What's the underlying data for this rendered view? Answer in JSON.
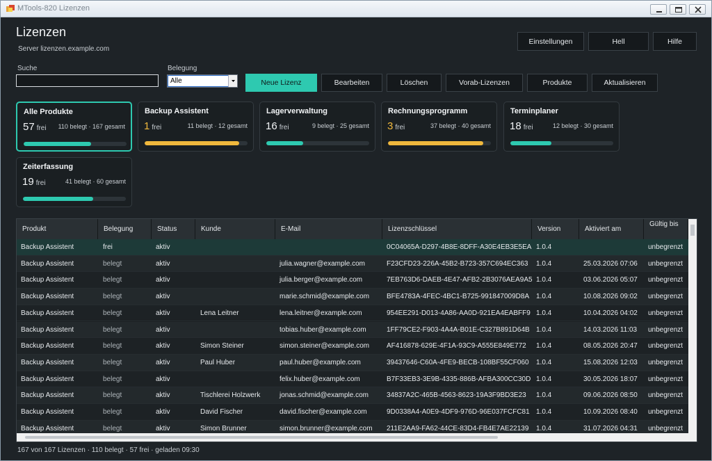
{
  "window": {
    "title": "MTools-820 Lizenzen"
  },
  "header": {
    "title": "Lizenzen",
    "server": "Server lizenzen.example.com",
    "buttons": {
      "settings": "Einstellungen",
      "theme": "Hell",
      "help": "Hilfe"
    }
  },
  "filters": {
    "search_label": "Suche",
    "search_value": "",
    "belegung_label": "Belegung",
    "belegung_value": "Alle"
  },
  "actions": {
    "new": "Neue Lizenz",
    "edit": "Bearbeiten",
    "delete": "Löschen",
    "prelicenses": "Vorab-Lizenzen",
    "products": "Produkte",
    "refresh": "Aktualisieren"
  },
  "colors": {
    "accent": "#2ec9b0",
    "warning": "#f0b83c",
    "background": "#1e2327"
  },
  "cards": [
    {
      "name": "Alle Produkte",
      "free": "57",
      "free_label": "frei",
      "stats": "110 belegt · 167 gesamt",
      "used": 110,
      "total": 167,
      "warn": false,
      "active": true
    },
    {
      "name": "Backup Assistent",
      "free": "1",
      "free_label": "frei",
      "stats": "11 belegt · 12 gesamt",
      "used": 11,
      "total": 12,
      "warn": true,
      "active": false
    },
    {
      "name": "Lagerverwaltung",
      "free": "16",
      "free_label": "frei",
      "stats": "9 belegt · 25 gesamt",
      "used": 9,
      "total": 25,
      "warn": false,
      "active": false
    },
    {
      "name": "Rechnungsprogramm",
      "free": "3",
      "free_label": "frei",
      "stats": "37 belegt · 40 gesamt",
      "used": 37,
      "total": 40,
      "warn": true,
      "active": false
    },
    {
      "name": "Terminplaner",
      "free": "18",
      "free_label": "frei",
      "stats": "12 belegt · 30 gesamt",
      "used": 12,
      "total": 30,
      "warn": false,
      "active": false
    },
    {
      "name": "Zeiterfassung",
      "free": "19",
      "free_label": "frei",
      "stats": "41 belegt · 60 gesamt",
      "used": 41,
      "total": 60,
      "warn": false,
      "active": false
    }
  ],
  "table": {
    "columns": [
      "Produkt",
      "Belegung",
      "Status",
      "Kunde",
      "E-Mail",
      "Lizenzschlüssel",
      "Version",
      "Aktiviert am",
      "Gültig bis"
    ],
    "rows": [
      [
        "Backup Assistent",
        "frei",
        "aktiv",
        "",
        "",
        "0C04065A-D297-4B8E-8DFF-A30E4EB3E5EA",
        "1.0.4",
        "",
        "unbegrenzt"
      ],
      [
        "Backup Assistent",
        "belegt",
        "aktiv",
        "",
        "julia.wagner@example.com",
        "F23CFD23-226A-45B2-B723-357C694EC363",
        "1.0.4",
        "25.03.2026 07:06",
        "unbegrenzt"
      ],
      [
        "Backup Assistent",
        "belegt",
        "aktiv",
        "",
        "julia.berger@example.com",
        "7EB763D6-DAEB-4E47-AFB2-2B3076AEA9A5",
        "1.0.4",
        "03.06.2026 05:07",
        "unbegrenzt"
      ],
      [
        "Backup Assistent",
        "belegt",
        "aktiv",
        "",
        "marie.schmid@example.com",
        "BFE4783A-4FEC-4BC1-B725-991847009D8A",
        "1.0.4",
        "10.08.2026 09:02",
        "unbegrenzt"
      ],
      [
        "Backup Assistent",
        "belegt",
        "aktiv",
        "Lena Leitner",
        "lena.leitner@example.com",
        "954EE291-D013-4A86-AA0D-921EA4EABFF9",
        "1.0.4",
        "10.04.2026 04:02",
        "unbegrenzt"
      ],
      [
        "Backup Assistent",
        "belegt",
        "aktiv",
        "",
        "tobias.huber@example.com",
        "1FF79CE2-F903-4A4A-B01E-C327B891D64B",
        "1.0.4",
        "14.03.2026 11:03",
        "unbegrenzt"
      ],
      [
        "Backup Assistent",
        "belegt",
        "aktiv",
        "Simon Steiner",
        "simon.steiner@example.com",
        "AF416878-629E-4F1A-93C9-A555E849E772",
        "1.0.4",
        "08.05.2026 20:47",
        "unbegrenzt"
      ],
      [
        "Backup Assistent",
        "belegt",
        "aktiv",
        "Paul Huber",
        "paul.huber@example.com",
        "39437646-C60A-4FE9-BECB-108BF55CF060",
        "1.0.4",
        "15.08.2026 12:03",
        "unbegrenzt"
      ],
      [
        "Backup Assistent",
        "belegt",
        "aktiv",
        "",
        "felix.huber@example.com",
        "B7F33EB3-3E9B-4335-886B-AFBA300CC30D",
        "1.0.4",
        "30.05.2026 18:07",
        "unbegrenzt"
      ],
      [
        "Backup Assistent",
        "belegt",
        "aktiv",
        "Tischlerei Holzwerk",
        "jonas.schmid@example.com",
        "34837A2C-465B-4563-8623-19A3F9BD3E23",
        "1.0.4",
        "09.06.2026 08:50",
        "unbegrenzt"
      ],
      [
        "Backup Assistent",
        "belegt",
        "aktiv",
        "David Fischer",
        "david.fischer@example.com",
        "9D0338A4-A0E9-4DF9-976D-96E037FCFC81",
        "1.0.4",
        "10.09.2026 08:40",
        "unbegrenzt"
      ],
      [
        "Backup Assistent",
        "belegt",
        "aktiv",
        "Simon Brunner",
        "simon.brunner@example.com",
        "211E2AA9-FA62-44CE-83D4-FB4E7AE22139",
        "1.0.4",
        "31.07.2026 04:31",
        "unbegrenzt"
      ]
    ]
  },
  "status": "167 von 167 Lizenzen · 110 belegt · 57 frei · geladen 09:30"
}
